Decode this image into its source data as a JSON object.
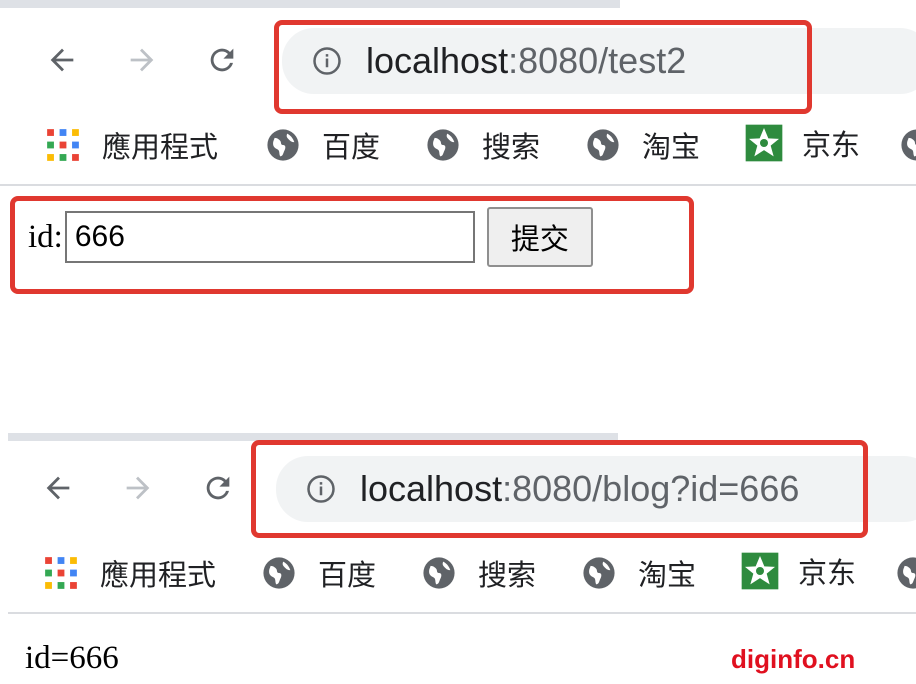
{
  "browser1": {
    "url_host": "localhost",
    "url_path": ":8080/test2",
    "bookmarks": [
      {
        "label": "應用程式",
        "icon": "apps-grid-icon"
      },
      {
        "label": "百度",
        "icon": "globe-icon"
      },
      {
        "label": "搜索",
        "icon": "globe-icon"
      },
      {
        "label": "淘宝",
        "icon": "globe-icon"
      },
      {
        "label": "京东",
        "icon": "jd-star-icon"
      }
    ]
  },
  "form": {
    "id_label": "id:",
    "id_value": "666",
    "submit_label": "提交"
  },
  "browser2": {
    "url_host": "localhost",
    "url_path": ":8080/blog?id=666",
    "bookmarks": [
      {
        "label": "應用程式",
        "icon": "apps-grid-icon"
      },
      {
        "label": "百度",
        "icon": "globe-icon"
      },
      {
        "label": "搜索",
        "icon": "globe-icon"
      },
      {
        "label": "淘宝",
        "icon": "globe-icon"
      },
      {
        "label": "京东",
        "icon": "jd-star-icon"
      }
    ]
  },
  "result": {
    "text": "id=666"
  },
  "watermark": {
    "text": "diginfo.cn"
  },
  "colors": {
    "highlight": "#e0382f",
    "omnibox": "#f1f3f4",
    "watermark": "#e0101f"
  }
}
